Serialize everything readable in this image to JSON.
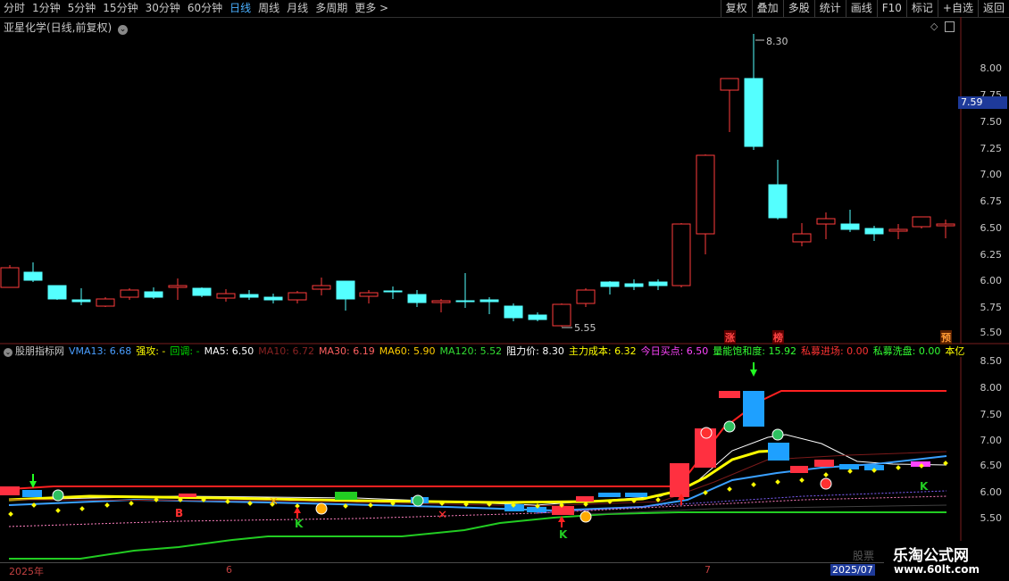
{
  "toolbar": {
    "tabs": [
      "分时",
      "1分钟",
      "5分钟",
      "15分钟",
      "30分钟",
      "60分钟",
      "日线",
      "周线",
      "月线",
      "多周期",
      "更多 >"
    ],
    "active_tab": "日线",
    "right_buttons": [
      "复权",
      "叠加",
      "多股",
      "统计",
      "画线",
      "F10",
      "标记",
      "+自选",
      "返回"
    ]
  },
  "main_chart": {
    "title": "亚星化学(日线,前复权)",
    "price_axis": [
      "8.00",
      "7.75",
      "7.50",
      "7.25",
      "7.00",
      "6.75",
      "6.50",
      "6.25",
      "6.00",
      "5.75",
      "5.50"
    ],
    "current_price": "7.59",
    "high_label": "8.30",
    "low_label": "5.55",
    "markers": [
      "涨",
      "榜",
      "预"
    ],
    "colors": {
      "up": "#ff3c3c",
      "down": "#54ffff"
    }
  },
  "indicator": {
    "name": "股朋指标网",
    "items": [
      {
        "text": "VMA13: 6.68",
        "color": "#4a9eff"
      },
      {
        "text": "强攻: -",
        "color": "#ffff00"
      },
      {
        "text": "回调: -",
        "color": "#00dd00"
      },
      {
        "text": "MA5: 6.50",
        "color": "#ffffff"
      },
      {
        "text": "MA10: 6.72",
        "color": "#882222"
      },
      {
        "text": "MA30: 6.19",
        "color": "#ff6060"
      },
      {
        "text": "MA60: 5.90",
        "color": "#ffcc00"
      },
      {
        "text": "MA120: 5.52",
        "color": "#33dd33"
      },
      {
        "text": "阻力价: 8.30",
        "color": "#ffffff"
      },
      {
        "text": "主力成本: 6.32",
        "color": "#ffff00"
      },
      {
        "text": "今日买点: 6.50",
        "color": "#ff44ff"
      },
      {
        "text": "量能饱和度: 15.92",
        "color": "#33ff33"
      },
      {
        "text": "私募进场: 0.00",
        "color": "#ff3333"
      },
      {
        "text": "私募洗盘: 0.00",
        "color": "#33ff33"
      },
      {
        "text": "本亿",
        "color": "#ffff00"
      }
    ],
    "axis": [
      "8.50",
      "8.00",
      "7.50",
      "7.00",
      "6.50",
      "6.00",
      "5.50"
    ],
    "signal_labels": [
      "B",
      "K",
      "K",
      "K"
    ]
  },
  "datebar": {
    "labels": [
      "2025年",
      "6",
      "7",
      "2025/07"
    ]
  },
  "watermark": {
    "line1": "乐淘公式网",
    "line2": "www.60lt.com",
    "faint": "股票"
  }
}
